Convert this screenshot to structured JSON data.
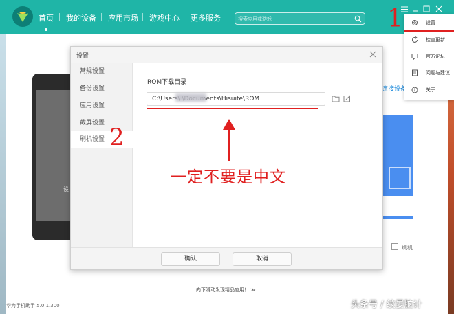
{
  "app": {
    "version": "华为手机助手 5.0.1.300"
  },
  "nav": {
    "items": [
      {
        "label": "首页"
      },
      {
        "label": "我的设备"
      },
      {
        "label": "应用市场"
      },
      {
        "label": "游戏中心"
      },
      {
        "label": "更多服务"
      }
    ],
    "active_index": 0
  },
  "search": {
    "placeholder": "搜索应用或游戏"
  },
  "window": {
    "controls": [
      "menu-icon",
      "minimize-icon",
      "maximize-icon",
      "close-icon"
    ]
  },
  "menu": {
    "items": [
      {
        "label": "设置",
        "icon": "gear-icon"
      },
      {
        "label": "检查更新",
        "icon": "refresh-icon"
      },
      {
        "label": "官方论坛",
        "icon": "forum-icon"
      },
      {
        "label": "问题与建议",
        "icon": "feedback-icon"
      },
      {
        "label": "关于",
        "icon": "info-icon"
      }
    ]
  },
  "background": {
    "connect_link": "连接设备",
    "phone_text": "设",
    "flash_label": "刷机",
    "scroll_hint": "向下滑动发现精品应用！ ≫"
  },
  "dialog": {
    "title": "设置",
    "sidebar": [
      {
        "label": "常规设置"
      },
      {
        "label": "备份设置"
      },
      {
        "label": "应用设置"
      },
      {
        "label": "截屏设置"
      },
      {
        "label": "刷机设置"
      }
    ],
    "active_index": 4,
    "rom_label": "ROM下载目录",
    "rom_path": "C:\\Users\\            \\Documents\\Hisuite\\ROM",
    "confirm": "确认",
    "cancel": "取消"
  },
  "annotations": {
    "note": "一定不要是中文",
    "step1": "1",
    "step2": "2"
  },
  "watermark": "头条号 / 纹晏脑计",
  "colors": {
    "accent": "#1fb5a7",
    "annotation_red": "#e02020",
    "link_blue": "#1f8bdb"
  }
}
